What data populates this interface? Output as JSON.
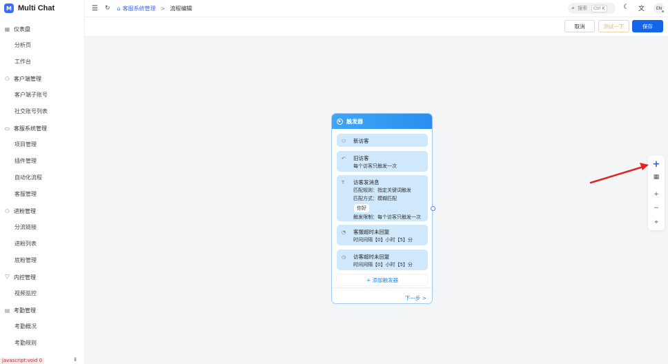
{
  "app": {
    "logo_letter": "M",
    "name": "Multi Chat"
  },
  "sidebar": {
    "groups": [
      {
        "icon": "dashboard-icon",
        "glyph": "▦",
        "label": "仪表盘",
        "items": [
          "分析页",
          "工作台"
        ]
      },
      {
        "icon": "user-icon",
        "glyph": "⚇",
        "label": "客户端管理",
        "items": [
          "客户端子账号",
          "社交账号列表"
        ]
      },
      {
        "icon": "briefcase-icon",
        "glyph": "▭",
        "label": "客服系统管理",
        "items": [
          "项目管理",
          "插件管理",
          "自动化流程",
          "客服管理"
        ]
      },
      {
        "icon": "user-add-icon",
        "glyph": "⚇",
        "label": "进粉管理",
        "items": [
          "分流链接",
          "进粉列表",
          "底粉管理"
        ]
      },
      {
        "icon": "shield-icon",
        "glyph": "⛉",
        "label": "内控管理",
        "items": [
          "视频监控"
        ]
      },
      {
        "icon": "calendar-icon",
        "glyph": "▤",
        "label": "考勤管理",
        "items": [
          "考勤概况",
          "考勤规则"
        ]
      }
    ],
    "status_tip": "javascript:void 0",
    "collapse_icon": "pin-icon"
  },
  "header": {
    "menu_icon": "hamburger-icon",
    "refresh_icon": "refresh-icon",
    "breadcrumb": {
      "parent": "客服系统管理",
      "separator": ">",
      "current": "流程编辑"
    },
    "search": {
      "label": "搜索",
      "shortcut": "Ctrl K"
    },
    "avatar_text": "EN"
  },
  "actions": {
    "cancel": "取消",
    "test": "测试一下",
    "save": "保存"
  },
  "trigger_card": {
    "title": "触发器",
    "triggers": [
      {
        "icon": "user-plus-icon",
        "glyph": "⚇",
        "title": "新访客",
        "lines": []
      },
      {
        "icon": "return-icon",
        "glyph": "↶",
        "title": "旧访客",
        "lines": [
          "每个访客只触发一次"
        ]
      },
      {
        "icon": "text-icon",
        "glyph": "T",
        "title": "访客发消息",
        "lines": [
          "匹配规则：指定关键词触发",
          "匹配方式：模糊匹配",
          "触发限制：每个访客只触发一次"
        ],
        "keyword": "你好"
      },
      {
        "icon": "headset-icon",
        "glyph": "◔",
        "title": "客服超时未回复",
        "lines": [
          "时间间隔【0】小时【5】分"
        ]
      },
      {
        "icon": "timer-icon",
        "glyph": "◷",
        "title": "访客超时未回复",
        "lines": [
          "时间间隔【0】小时【5】分"
        ]
      }
    ],
    "add_trigger": "+ 添加触发器",
    "next_step": "下一步 >"
  },
  "canvas_toolbar": {
    "add": "+",
    "grid": "▦",
    "zoom_in": "+",
    "zoom_out": "−",
    "fit": "⌖"
  },
  "colors": {
    "primary": "#1565e8",
    "card_header": "#2a8ef0",
    "trigger_bg": "#cfe8fb",
    "annotation_arrow": "#e02424"
  }
}
